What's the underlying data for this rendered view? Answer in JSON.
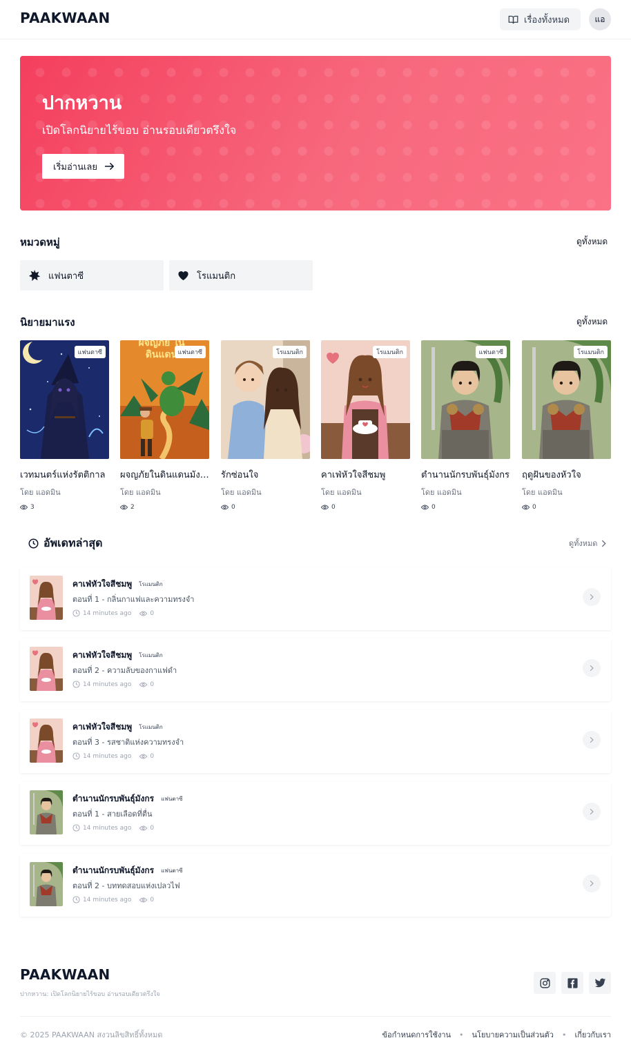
{
  "header": {
    "logo": "PAAKWAAN",
    "all_stories_label": "เรื่องทั้งหมด",
    "avatar_initials": "แอ"
  },
  "hero": {
    "title": "ปากหวาน",
    "subtitle": "เปิดโลกนิยายไร้ขอบ อ่านรอบเดียวตรึงใจ",
    "cta_label": "เริ่มอ่านเลย",
    "gradient_colors": [
      "#f43f5e",
      "#fb7185"
    ]
  },
  "categories": {
    "title": "หมวดหมู่",
    "view_all": "ดูทั้งหมด",
    "items": [
      {
        "label": "แฟนตาซี",
        "icon": "star-burst-icon"
      },
      {
        "label": "โรแมนติก",
        "icon": "heart-icon"
      }
    ]
  },
  "popular": {
    "title": "นิยายมาแรง",
    "view_all": "ดูทั้งหมด",
    "books": [
      {
        "title": "เวทมนตร์แห่งรัตติกาล",
        "author": "โดย แอดมิน",
        "views": "3",
        "tag": "แฟนตาซี"
      },
      {
        "title": "ผจญภัยในดินแดนมังกร",
        "author": "โดย แอดมิน",
        "views": "2",
        "tag": "แฟนตาซี"
      },
      {
        "title": "รักซ่อนใจ",
        "author": "โดย แอดมิน",
        "views": "0",
        "tag": "โรแมนติก"
      },
      {
        "title": "คาเฟ่หัวใจสีชมพู",
        "author": "โดย แอดมิน",
        "views": "0",
        "tag": "โรแมนติก"
      },
      {
        "title": "ตำนานนักรบพันธุ์มังกร",
        "author": "โดย แอดมิน",
        "views": "0",
        "tag": "แฟนตาซี"
      },
      {
        "title": "ฤดูฝันของหัวใจ",
        "author": "โดย แอดมิน",
        "views": "0",
        "tag": "โรแมนติก"
      }
    ],
    "cover_text_partial": "ผจญภัย ในดินแดน"
  },
  "updates": {
    "title": "อัพเดทล่าสุด",
    "view_all": "ดูทั้งหมด",
    "items": [
      {
        "title": "คาเฟ่หัวใจสีชมพู",
        "tag": "โรแมนติก",
        "episode": "ตอนที่ 1 - กลิ่นกาแฟและความทรงจำ",
        "time": "14 minutes ago",
        "views": "0"
      },
      {
        "title": "คาเฟ่หัวใจสีชมพู",
        "tag": "โรแมนติก",
        "episode": "ตอนที่ 2 - ความลับของกาแฟดำ",
        "time": "14 minutes ago",
        "views": "0"
      },
      {
        "title": "คาเฟ่หัวใจสีชมพู",
        "tag": "โรแมนติก",
        "episode": "ตอนที่ 3 - รสชาติแห่งความทรงจำ",
        "time": "14 minutes ago",
        "views": "0"
      },
      {
        "title": "ตำนานนักรบพันธุ์มังกร",
        "tag": "แฟนตาซี",
        "episode": "ตอนที่ 1 - สายเลือดที่ตื่น",
        "time": "14 minutes ago",
        "views": "0"
      },
      {
        "title": "ตำนานนักรบพันธุ์มังกร",
        "tag": "แฟนตาซี",
        "episode": "ตอนที่ 2 - บททดสอบแห่งเปลวไฟ",
        "time": "14 minutes ago",
        "views": "0"
      }
    ]
  },
  "footer": {
    "logo": "PAAKWAAN",
    "tagline": "ปากหวาน: เปิดโลกนิยายไร้ขอบ อ่านรอบเดียวตรึงใจ",
    "copyright": "© 2025 PAAKWAAN สงวนลิขสิทธิ์ทั้งหมด",
    "links": [
      "ข้อกำหนดการใช้งาน",
      "นโยบายความเป็นส่วนตัว",
      "เกี่ยวกับเรา"
    ],
    "social": [
      "instagram-icon",
      "facebook-icon",
      "twitter-icon"
    ]
  }
}
